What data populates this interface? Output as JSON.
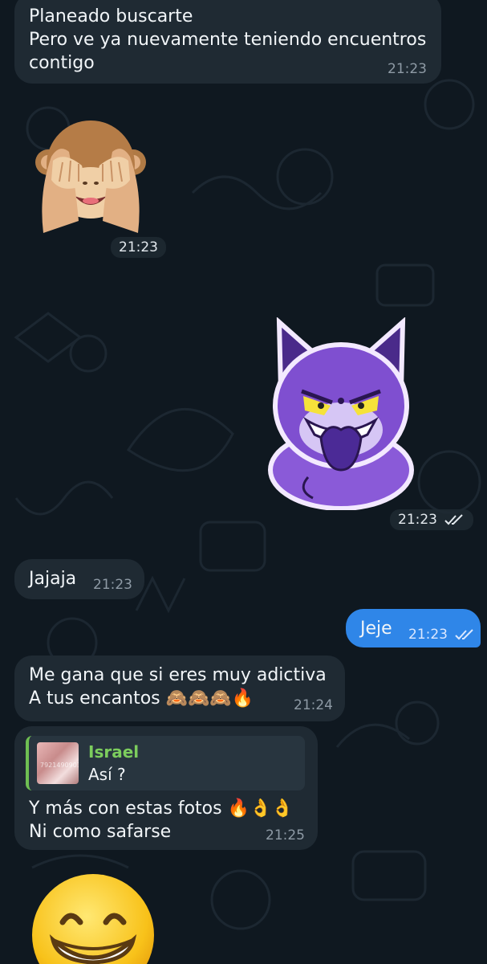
{
  "messages": {
    "m1": {
      "lines": "Planeado buscarte\nPero ve ya nuevamente teniendo encuentros\ncontigo",
      "time": "21:23"
    },
    "m2": {
      "sticker": "see-no-evil-monkey",
      "time": "21:23"
    },
    "m3": {
      "sticker": "purple-devil-cat",
      "time": "21:23",
      "status": "read"
    },
    "m4": {
      "text": "Jajaja",
      "time": "21:23"
    },
    "m5": {
      "text": "Jeje",
      "time": "21:23",
      "status": "read"
    },
    "m6": {
      "lines": "Me gana que si eres muy adictiva\nA tus encantos 🙈🙈🙈🔥",
      "time": "21:24"
    },
    "m7": {
      "reply": {
        "name": "Israel",
        "text": "Así ?",
        "thumb_caption": "7921490901"
      },
      "lines": "Y más con estas fotos 🔥👌👌\nNi como safarse",
      "time": "21:25"
    },
    "m8": {
      "sticker": "grinning-face"
    }
  },
  "colors": {
    "background": "#0f1820",
    "incoming_bubble": "#1f2a33",
    "outgoing_bubble": "#2f86e8",
    "reply_accent": "#7ccd5d"
  }
}
